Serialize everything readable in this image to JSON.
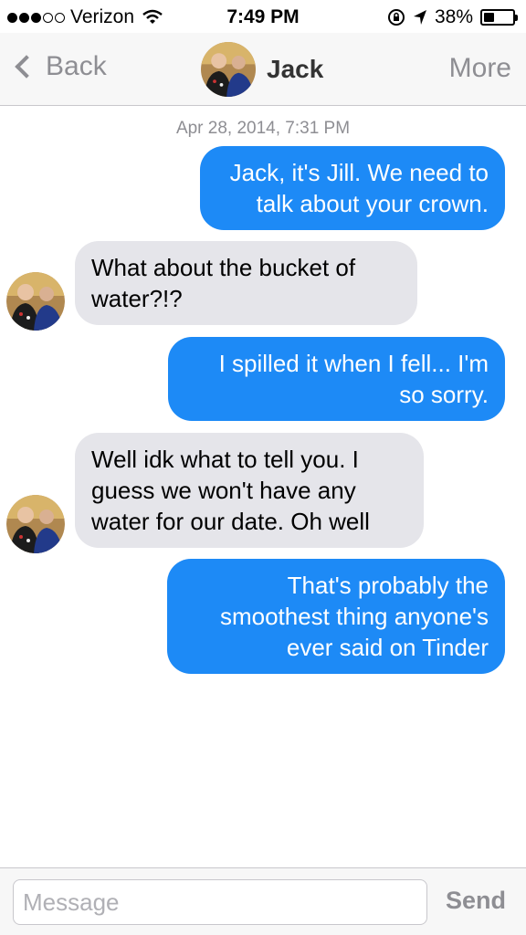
{
  "status_bar": {
    "carrier": "Verizon",
    "time": "7:49 PM",
    "battery": "38%",
    "battery_level": 0.38
  },
  "nav": {
    "back_label": "Back",
    "contact_name": "Jack",
    "more_label": "More"
  },
  "conversation": {
    "timestamp": "Apr 28, 2014, 7:31 PM",
    "messages": [
      {
        "direction": "out",
        "lines": [
          "Jack, it's Jill. We need to",
          "talk about your crown."
        ]
      },
      {
        "direction": "in",
        "lines": [
          "What about the bucket of",
          "water?!?"
        ]
      },
      {
        "direction": "out",
        "lines": [
          "I spilled it when I fell... I'm",
          "so sorry."
        ]
      },
      {
        "direction": "in",
        "lines": [
          "Well idk what to tell you. I",
          "guess we won't have any",
          "water for our date. Oh well"
        ]
      },
      {
        "direction": "out",
        "lines": [
          "That's probably the",
          "smoothest thing anyone's",
          "ever said on Tinder"
        ]
      }
    ]
  },
  "input_bar": {
    "placeholder": "Message",
    "send_label": "Send"
  },
  "colors": {
    "outgoing_bubble": "#1d8af6",
    "incoming_bubble": "#e5e5ea",
    "nav_gray": "#8e8e93"
  },
  "icons": [
    "signal-dots-icon",
    "wifi-icon",
    "lock-rotation-icon",
    "location-arrow-icon",
    "battery-icon",
    "back-chevron-icon"
  ]
}
